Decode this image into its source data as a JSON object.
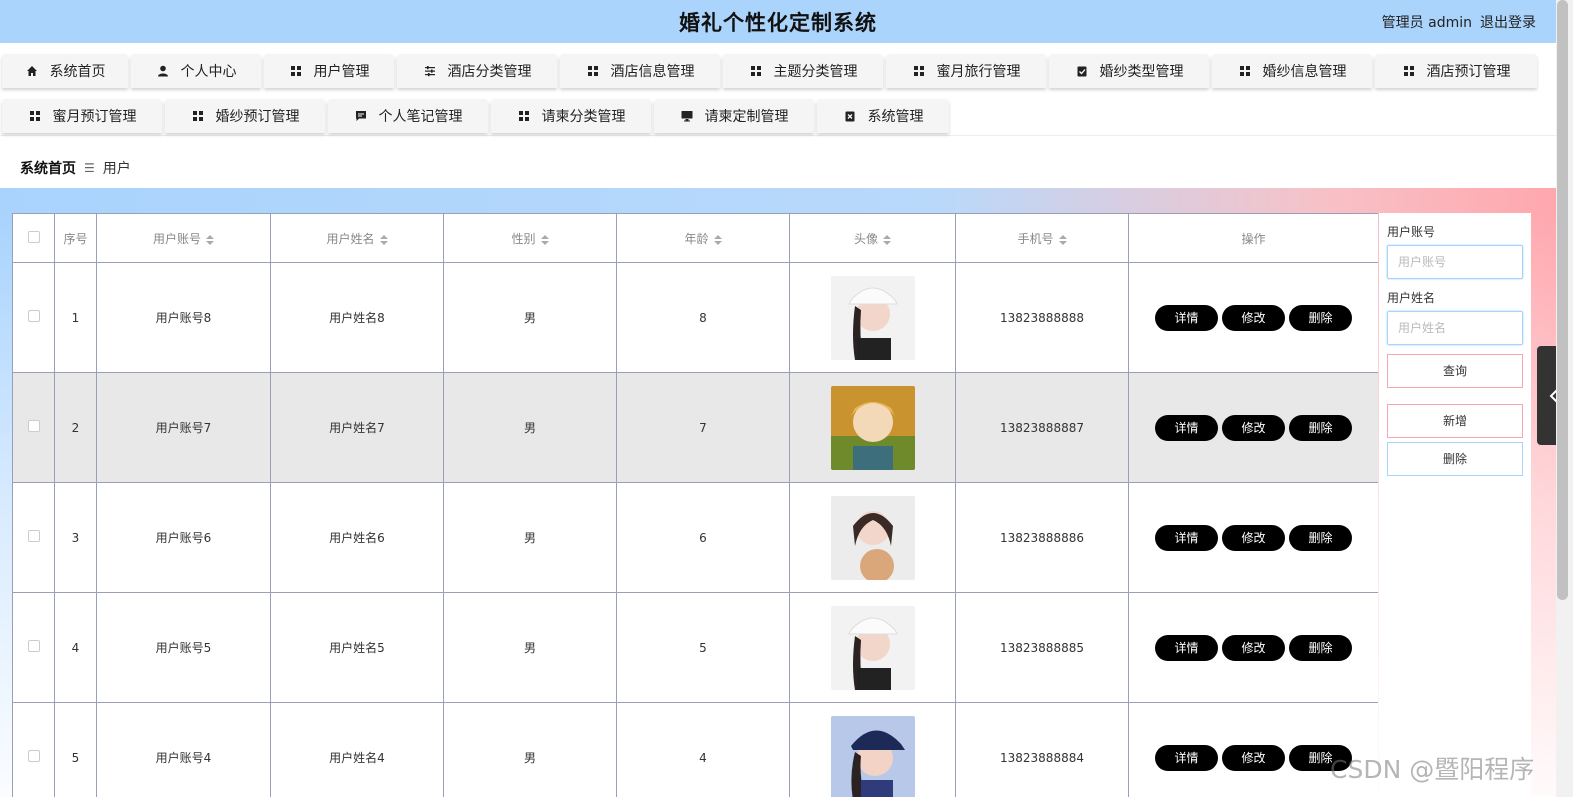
{
  "header": {
    "title": "婚礼个性化定制系统",
    "user_role": "管理员 admin",
    "logout_label": "退出登录"
  },
  "nav": {
    "row1": [
      {
        "label": "系统首页",
        "icon": "home-icon"
      },
      {
        "label": "个人中心",
        "icon": "user-icon"
      },
      {
        "label": "用户管理",
        "icon": "grid-icon"
      },
      {
        "label": "酒店分类管理",
        "icon": "sliders-icon"
      },
      {
        "label": "酒店信息管理",
        "icon": "grid-icon"
      },
      {
        "label": "主题分类管理",
        "icon": "grid-icon"
      },
      {
        "label": "蜜月旅行管理",
        "icon": "grid-icon"
      },
      {
        "label": "婚纱类型管理",
        "icon": "clipboard-icon"
      },
      {
        "label": "婚纱信息管理",
        "icon": "grid-icon"
      },
      {
        "label": "酒店预订管理",
        "icon": "grid-icon"
      }
    ],
    "row2": [
      {
        "label": "蜜月预订管理",
        "icon": "grid-icon"
      },
      {
        "label": "婚纱预订管理",
        "icon": "grid-icon"
      },
      {
        "label": "个人笔记管理",
        "icon": "chat-icon"
      },
      {
        "label": "请柬分类管理",
        "icon": "grid-icon"
      },
      {
        "label": "请柬定制管理",
        "icon": "monitor-icon"
      },
      {
        "label": "系统管理",
        "icon": "clipboard-x-icon"
      }
    ]
  },
  "breadcrumb": {
    "home": "系统首页",
    "current": "用户"
  },
  "table": {
    "columns": [
      "序号",
      "用户账号",
      "用户姓名",
      "性别",
      "年龄",
      "头像",
      "手机号",
      "操作"
    ],
    "rows": [
      {
        "index": "1",
        "account": "用户账号8",
        "name": "用户姓名8",
        "gender": "男",
        "age": "8",
        "avatar": "avatar-cap",
        "phone": "13823888888"
      },
      {
        "index": "2",
        "account": "用户账号7",
        "name": "用户姓名7",
        "gender": "男",
        "age": "7",
        "avatar": "avatar-anime",
        "phone": "13823888887"
      },
      {
        "index": "3",
        "account": "用户账号6",
        "name": "用户姓名6",
        "gender": "男",
        "age": "6",
        "avatar": "avatar-dog",
        "phone": "13823888886"
      },
      {
        "index": "4",
        "account": "用户账号5",
        "name": "用户姓名5",
        "gender": "男",
        "age": "5",
        "avatar": "avatar-cap",
        "phone": "13823888885"
      },
      {
        "index": "5",
        "account": "用户账号4",
        "name": "用户姓名4",
        "gender": "男",
        "age": "4",
        "avatar": "avatar-blue-cap",
        "phone": "13823888884"
      }
    ],
    "actions": {
      "detail": "详情",
      "edit": "修改",
      "delete": "删除"
    }
  },
  "search": {
    "account_label": "用户账号",
    "account_placeholder": "用户账号",
    "name_label": "用户姓名",
    "name_placeholder": "用户姓名",
    "query_label": "查询",
    "add_label": "新增",
    "delete_label": "删除"
  },
  "watermark": "CSDN @暨阳程序"
}
